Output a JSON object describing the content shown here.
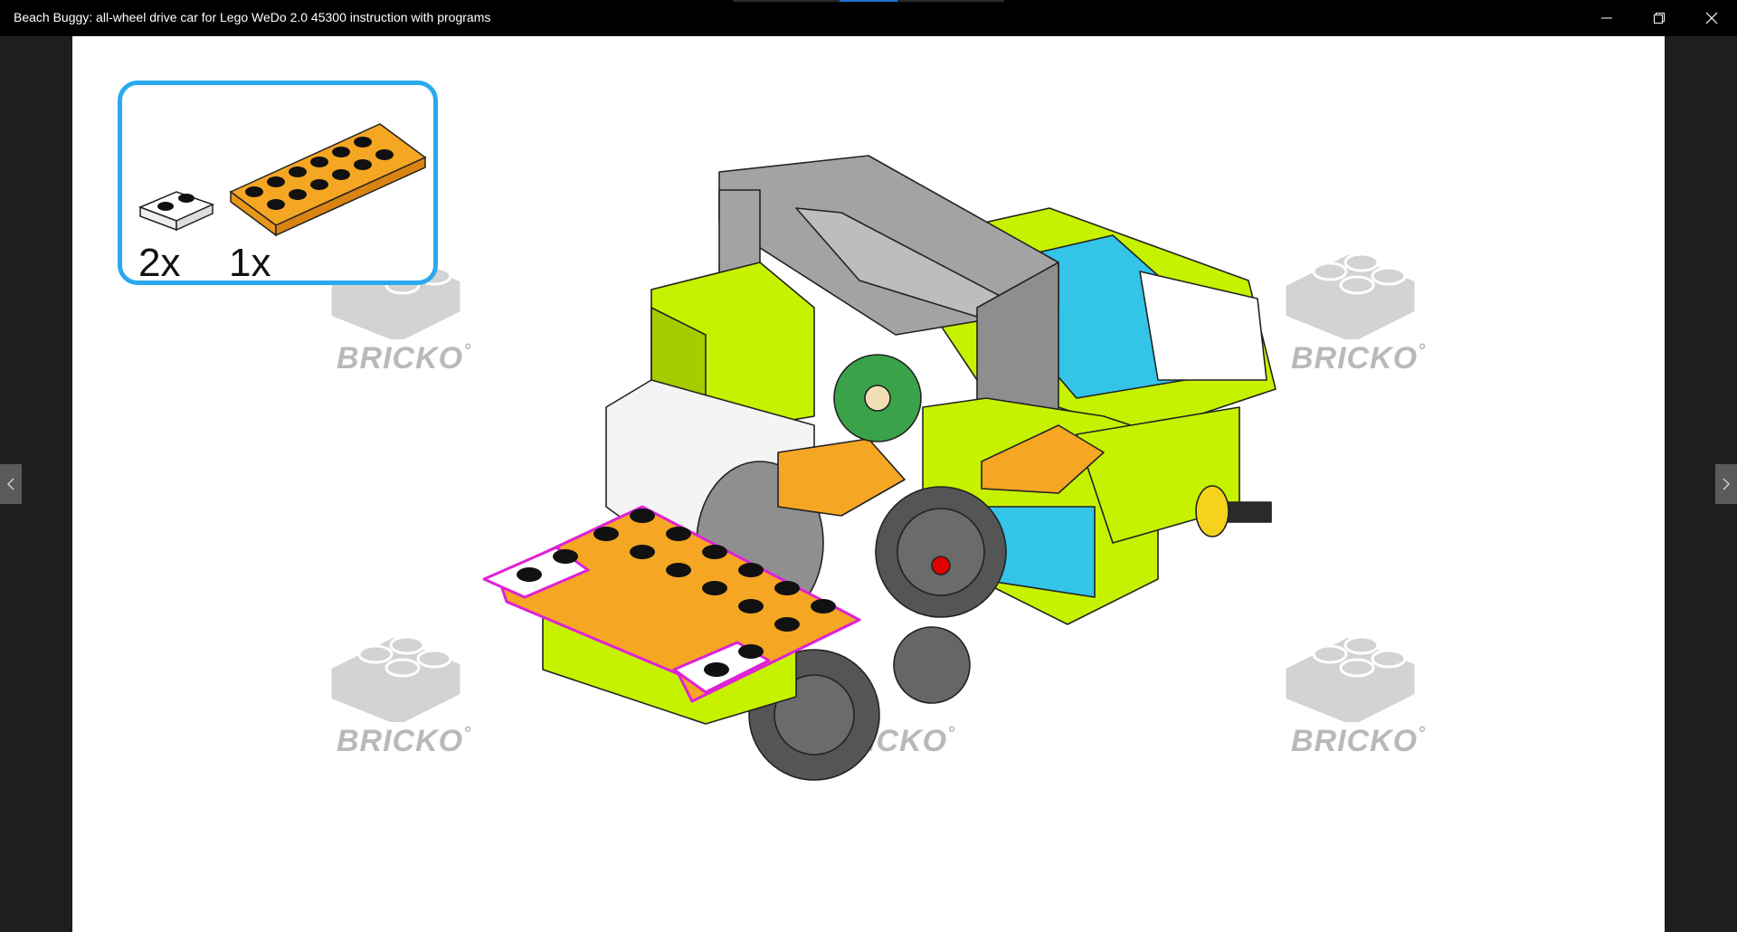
{
  "window": {
    "title": "Beach Buggy: all-wheel drive car for Lego WeDo 2.0 45300 instruction with programs",
    "controls": {
      "minimize_icon": "minimize-icon",
      "restore_icon": "restore-icon",
      "close_icon": "close-icon"
    }
  },
  "navigation": {
    "prev_icon": "chevron-left-icon",
    "next_icon": "chevron-right-icon"
  },
  "instruction_step": {
    "parts_callout": {
      "items": [
        {
          "part": "white 1x2 plate",
          "quantity": "2x"
        },
        {
          "part": "orange 2x6 plate",
          "quantity": "1x"
        }
      ],
      "border_color": "#2aa9ee"
    },
    "watermark": {
      "text": "BRICKO",
      "symbol": "°",
      "color": "#b9b9b9"
    },
    "highlight_color": "#e020d8",
    "brick_colors": {
      "lime": "#c6f200",
      "azure": "#34c4e8",
      "orange": "#f5a623",
      "dark_gray": "#5c5c5c",
      "light_gray": "#a3a3a3",
      "white": "#ffffff",
      "green": "#2e9a3c"
    }
  }
}
